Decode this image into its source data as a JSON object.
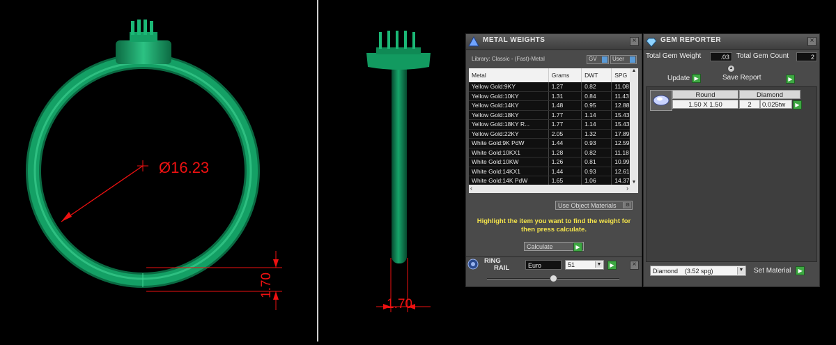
{
  "viewport": {
    "diameter_label": "Ø16.23",
    "width_label_front": "1.70",
    "width_label_side": "1.70",
    "ring_color": "#11995e",
    "dim_color": "#e11111"
  },
  "metal_weights": {
    "title": "METAL WEIGHTS",
    "library": "Library: Classic - (Fast)-Metal",
    "toggle_gv": "GV",
    "toggle_user": "User",
    "columns": [
      "Metal",
      "Grams",
      "DWT",
      "SPG"
    ],
    "rows": [
      [
        "Yellow Gold:9KY",
        "1.27",
        "0.82",
        "11.08"
      ],
      [
        "Yellow Gold:10KY",
        "1.31",
        "0.84",
        "11.43"
      ],
      [
        "Yellow Gold:14KY",
        "1.48",
        "0.95",
        "12.88"
      ],
      [
        "Yellow Gold:18KY",
        "1.77",
        "1.14",
        "15.43"
      ],
      [
        "Yellow Gold:18KY R...",
        "1.77",
        "1.14",
        "15.43"
      ],
      [
        "Yellow Gold:22KY",
        "2.05",
        "1.32",
        "17.89"
      ],
      [
        "White Gold:9K PdW",
        "1.44",
        "0.93",
        "12.59"
      ],
      [
        "White Gold:10KX1",
        "1.28",
        "0.82",
        "11.18"
      ],
      [
        "White Gold:10KW",
        "1.26",
        "0.81",
        "10.99"
      ],
      [
        "White Gold:14KX1",
        "1.44",
        "0.93",
        "12.61"
      ],
      [
        "White Gold:14K PdW",
        "1.65",
        "1.06",
        "14.37"
      ]
    ],
    "use_object_materials": "Use Object Materials",
    "hint": "Highlight the item you want to find the weight for then press calculate.",
    "calculate": "Calculate"
  },
  "ring_rail": {
    "title_line1": "RING",
    "title_line2": "RAIL",
    "standard": "Euro",
    "size": "51"
  },
  "gem_reporter": {
    "title": "GEM REPORTER",
    "total_weight_label": "Total Gem Weight",
    "total_weight_value": ".03",
    "total_count_label": "Total Gem Count",
    "total_count_value": "2",
    "update": "Update",
    "save_report": "Save Report",
    "gem_cut": "Round",
    "gem_type": "Diamond",
    "gem_size": "1.50 X 1.50",
    "gem_count": "2",
    "gem_weight": "0.025tw",
    "material_select": "Diamond    (3.52 spg)",
    "set_material": "Set Material"
  }
}
